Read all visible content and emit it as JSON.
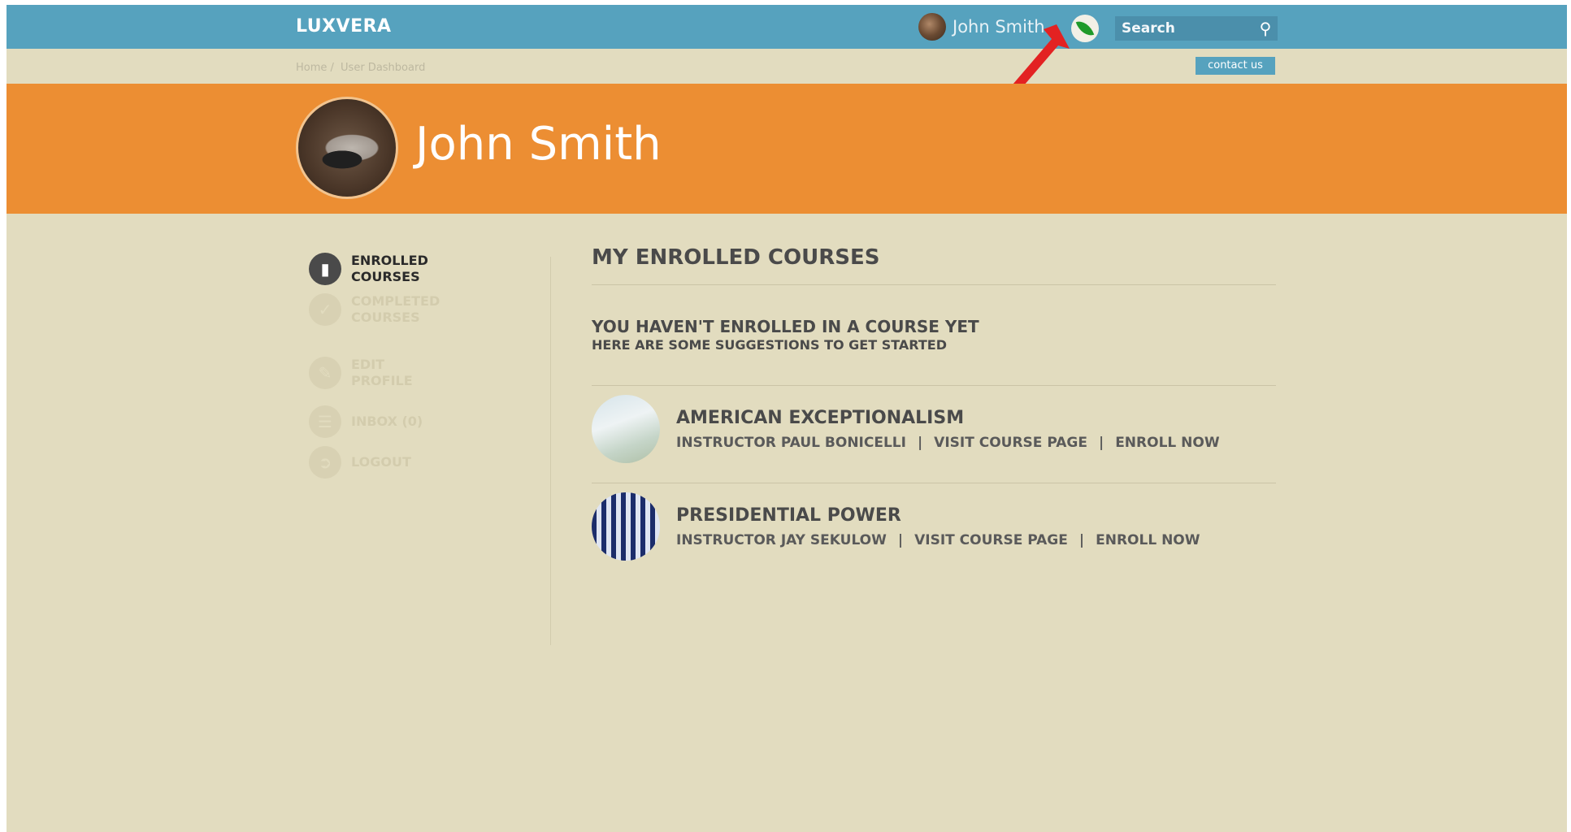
{
  "header": {
    "logo": "LUXVERA",
    "user_name": "John Smith",
    "search_placeholder": "Search",
    "contact_label": "contact us"
  },
  "breadcrumb": {
    "items": [
      "Home /",
      "User Dashboard"
    ]
  },
  "profile": {
    "name": "John Smith"
  },
  "sidebar": {
    "items": [
      {
        "label": "Enrolled Courses",
        "icon": "book-icon"
      },
      {
        "label": "Completed Courses",
        "icon": "check-circle-icon"
      },
      {
        "label": "Edit Profile",
        "icon": "edit-icon"
      },
      {
        "label": "Inbox (0)",
        "icon": "inbox-icon"
      },
      {
        "label": "Logout",
        "icon": "logout-icon"
      }
    ]
  },
  "main": {
    "title": "MY ENROLLED COURSES",
    "notice_title": "YOU HAVEN'T ENROLLED IN A COURSE YET",
    "notice_sub": "HERE ARE SOME SUGGESTIONS TO GET STARTED",
    "courses": [
      {
        "title": "AMERICAN EXCEPTIONALISM",
        "instructor": "INSTRUCTOR PAUL BONICELLI",
        "visit": "VISIT COURSE PAGE",
        "enroll": "ENROLL NOW"
      },
      {
        "title": "PRESIDENTIAL POWER",
        "instructor": "INSTRUCTOR JAY SEKULOW",
        "visit": "VISIT COURSE PAGE",
        "enroll": "ENROLL NOW"
      }
    ],
    "separator": "|"
  },
  "colors": {
    "topbar": "#56a2be",
    "banner": "#ec8e33",
    "background": "#e2dcbf",
    "arrow": "#e32222"
  }
}
